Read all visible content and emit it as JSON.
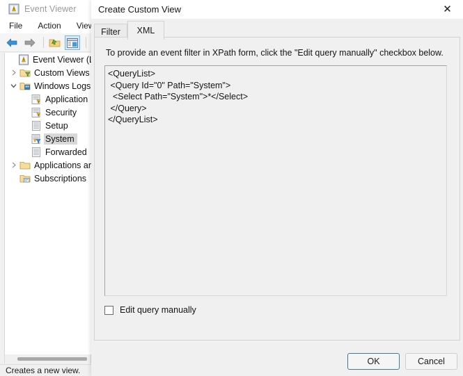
{
  "background_window": {
    "title": "Event Viewer",
    "title_icon": "event-viewer-icon",
    "menu": [
      {
        "label": "File"
      },
      {
        "label": "Action"
      },
      {
        "label": "View"
      }
    ],
    "toolbar": [
      {
        "icon": "back-arrow-icon",
        "active": false
      },
      {
        "icon": "forward-arrow-icon",
        "active": false
      },
      {
        "icon": "open-folder-icon",
        "active": false
      },
      {
        "icon": "show-hide-console-tree-icon",
        "active": true
      },
      {
        "icon": "help-icon",
        "active": false
      }
    ],
    "tree": [
      {
        "label": "Event Viewer (Loca",
        "icon": "event-viewer-icon",
        "twisty": "none",
        "indent": 0,
        "selected": false
      },
      {
        "label": "Custom Views",
        "icon": "custom-views-folder-icon",
        "twisty": "collapsed",
        "indent": 1,
        "selected": false
      },
      {
        "label": "Windows Logs",
        "icon": "windows-logs-folder-icon",
        "twisty": "expanded",
        "indent": 1,
        "selected": false
      },
      {
        "label": "Application",
        "icon": "log-icon",
        "twisty": "none",
        "indent": 2,
        "selected": false
      },
      {
        "label": "Security",
        "icon": "log-icon",
        "twisty": "none",
        "indent": 2,
        "selected": false
      },
      {
        "label": "Setup",
        "icon": "plain-log-icon",
        "twisty": "none",
        "indent": 2,
        "selected": false
      },
      {
        "label": "System",
        "icon": "log-filtered-icon",
        "twisty": "none",
        "indent": 2,
        "selected": true
      },
      {
        "label": "Forwarded",
        "icon": "plain-log-icon",
        "twisty": "none",
        "indent": 2,
        "selected": false
      },
      {
        "label": "Applications ar",
        "icon": "applications-folder-icon",
        "twisty": "collapsed",
        "indent": 1,
        "selected": false
      },
      {
        "label": "Subscriptions",
        "icon": "subscriptions-icon",
        "twisty": "none",
        "indent": 1,
        "selected": false
      }
    ],
    "status_text": "Creates a new view."
  },
  "dialog": {
    "title": "Create Custom View",
    "close_icon": "close-icon",
    "tabs": [
      {
        "label": "Filter",
        "active": false
      },
      {
        "label": "XML",
        "active": true
      }
    ],
    "instruction": "To provide an event filter in XPath form, click the \"Edit query manually\" checkbox below.",
    "xml_query": "<QueryList>\n <Query Id=\"0\" Path=\"System\">\n  <Select Path=\"System\">*</Select>\n </Query>\n</QueryList>",
    "edit_manually": {
      "label": "Edit query manually",
      "checked": false
    },
    "buttons": [
      {
        "label": "OK",
        "default": true
      },
      {
        "label": "Cancel",
        "default": false
      }
    ]
  },
  "colors": {
    "dialog_background": "#f0f0f0",
    "accent_border": "#3a7ca8",
    "selection": "#d8d8d8",
    "toolbar_active": "#d6ebf9"
  }
}
